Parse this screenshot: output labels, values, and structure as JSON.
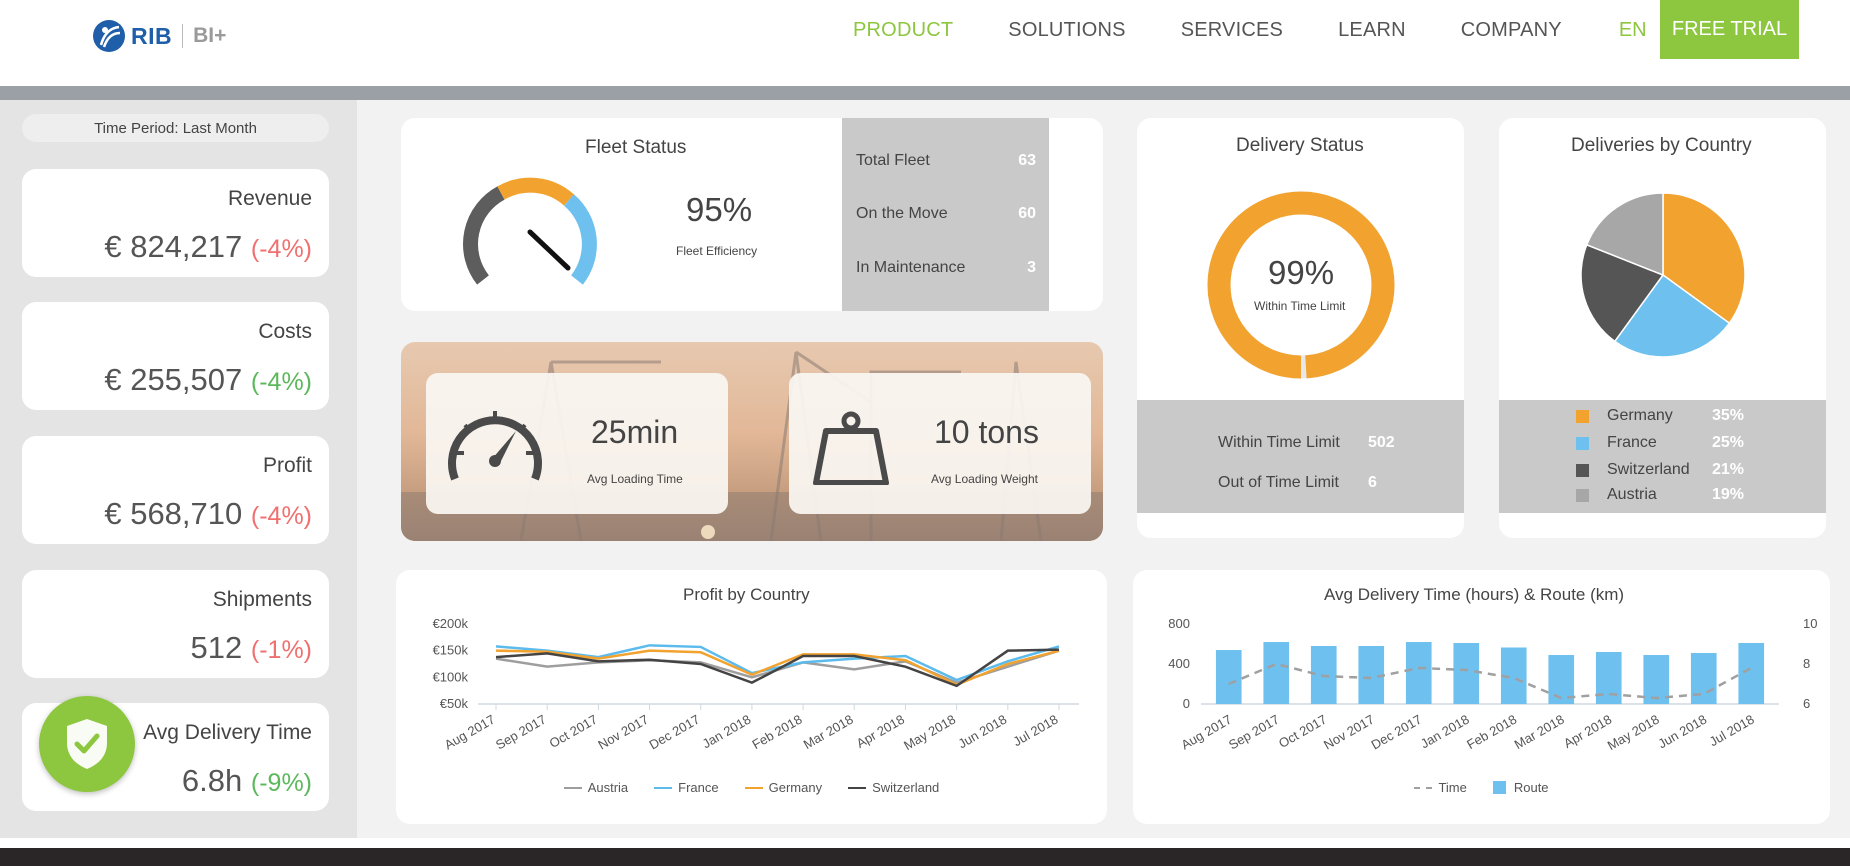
{
  "nav": {
    "logo_text": "RIB",
    "logo_sub": "BI+",
    "items": [
      {
        "label": "PRODUCT",
        "active": true
      },
      {
        "label": "SOLUTIONS",
        "active": false
      },
      {
        "label": "SERVICES",
        "active": false
      },
      {
        "label": "LEARN",
        "active": false
      },
      {
        "label": "COMPANY",
        "active": false
      }
    ],
    "lang": "EN",
    "cta": "FREE TRIAL"
  },
  "sidebar": {
    "period": "Time Period: Last Month",
    "kpis": [
      {
        "label": "Revenue",
        "value": "€ 824,217",
        "change": "(-4%)",
        "change_color": "#f07070"
      },
      {
        "label": "Costs",
        "value": "€ 255,507",
        "change": "(-4%)",
        "change_color": "#5cb85c"
      },
      {
        "label": "Profit",
        "value": "€ 568,710",
        "change": "(-4%)",
        "change_color": "#f07070"
      },
      {
        "label": "Shipments",
        "value": "512",
        "change": "(-1%)",
        "change_color": "#f07070"
      },
      {
        "label": "Avg Delivery Time",
        "value": "6.8h",
        "change": "(-9%)",
        "change_color": "#5cb85c"
      }
    ]
  },
  "fleet": {
    "title": "Fleet Status",
    "efficiency": "95%",
    "efficiency_label": "Fleet Efficiency",
    "gauge_value": 0.95,
    "rows": [
      {
        "label": "Total Fleet",
        "value": "63"
      },
      {
        "label": "On the Move",
        "value": "60"
      },
      {
        "label": "In Maintenance",
        "value": "3"
      }
    ]
  },
  "loading": {
    "time_value": "25min",
    "time_label": "Avg Loading Time",
    "weight_value": "10 tons",
    "weight_label": "Avg Loading Weight"
  },
  "delivery_status": {
    "title": "Delivery Status",
    "percent": "99%",
    "percent_label": "Within Time Limit",
    "ratio": 0.99,
    "rows": [
      {
        "label": "Within Time Limit",
        "value": "502"
      },
      {
        "label": "Out of Time Limit",
        "value": "6"
      }
    ]
  },
  "deliveries_by_country": {
    "title": "Deliveries by Country",
    "legend": [
      {
        "label": "Germany",
        "value": "35%",
        "share": 35,
        "color": "#f2a22e"
      },
      {
        "label": "France",
        "value": "25%",
        "share": 25,
        "color": "#6ec0ef"
      },
      {
        "label": "Switzerland",
        "value": "21%",
        "share": 21,
        "color": "#555555"
      },
      {
        "label": "Austria",
        "value": "19%",
        "share": 19,
        "color": "#a7a7a7"
      }
    ]
  },
  "chart_data": [
    {
      "type": "line",
      "title": "Profit by Country",
      "categories": [
        "Aug 2017",
        "Sep 2017",
        "Oct 2017",
        "Nov 2017",
        "Dec 2017",
        "Jan 2018",
        "Feb 2018",
        "Mar 2018",
        "Apr 2018",
        "May 2018",
        "Jun 2018",
        "Jul 2018"
      ],
      "yticks": [
        "€200k",
        "€150k",
        "€100k",
        "€50k"
      ],
      "ylim": [
        50,
        200
      ],
      "series": [
        {
          "name": "Austria",
          "color": "#9e9e9e",
          "values": [
            135,
            120,
            128,
            132,
            128,
            100,
            128,
            115,
            130,
            90,
            120,
            150
          ]
        },
        {
          "name": "France",
          "color": "#5bbbec",
          "values": [
            158,
            150,
            138,
            160,
            157,
            108,
            128,
            135,
            140,
            95,
            130,
            158
          ]
        },
        {
          "name": "Germany",
          "color": "#f2a22e",
          "values": [
            150,
            148,
            135,
            150,
            147,
            105,
            143,
            143,
            132,
            86,
            125,
            150
          ]
        },
        {
          "name": "Switzerland",
          "color": "#444444",
          "values": [
            138,
            145,
            130,
            133,
            125,
            90,
            140,
            140,
            120,
            84,
            150,
            152
          ]
        }
      ],
      "legend_position": "bottom"
    },
    {
      "type": "bar",
      "title": "Avg Delivery Time (hours) & Route (km)",
      "categories": [
        "Aug 2017",
        "Sep 2017",
        "Oct 2017",
        "Nov 2017",
        "Dec 2017",
        "Jan 2018",
        "Feb 2018",
        "Mar 2018",
        "Apr 2018",
        "May 2018",
        "Jun 2018",
        "Jul 2018"
      ],
      "yticks_left": [
        "800",
        "400",
        "0"
      ],
      "yticks_right": [
        "10",
        "8",
        "6"
      ],
      "ylim_left": [
        0,
        800
      ],
      "ylim_right": [
        6,
        10
      ],
      "series": [
        {
          "name": "Route",
          "color": "#6ec0ef",
          "kind": "bar",
          "values": [
            540,
            620,
            580,
            580,
            620,
            610,
            565,
            490,
            520,
            490,
            510,
            610
          ]
        },
        {
          "name": "Time",
          "color": "#a0a0a0",
          "kind": "dashed-line",
          "values": [
            7.0,
            8.0,
            7.4,
            7.3,
            7.8,
            7.7,
            7.3,
            6.3,
            6.5,
            6.3,
            6.5,
            7.8
          ]
        }
      ],
      "legend_position": "bottom"
    }
  ]
}
